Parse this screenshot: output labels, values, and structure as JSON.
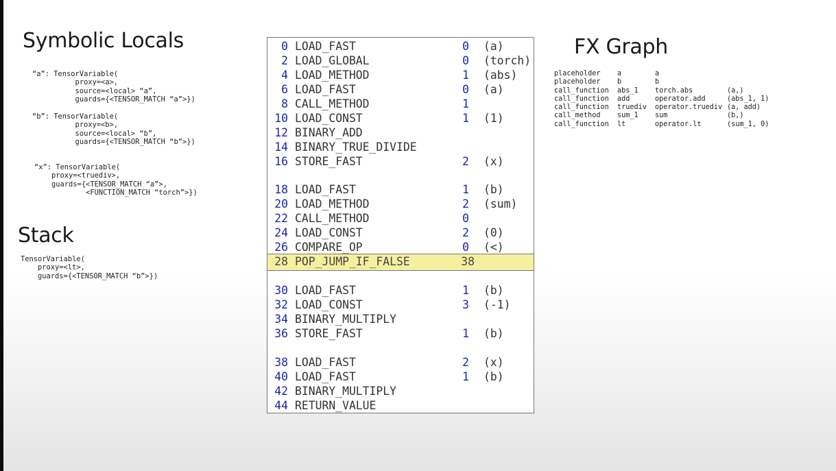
{
  "titles": {
    "symbolic_locals": "Symbolic Locals",
    "stack": "Stack",
    "fx_graph": "FX Graph"
  },
  "symbolic_locals": {
    "a": "“a”: TensorVariable(\n          proxy=<a>,\n          source=<local> “a”,\n          guards={<TENSOR_MATCH “a”>})",
    "b": "“b”: TensorVariable(\n          proxy=<b>,\n          source=<local> “b”,\n          guards={<TENSOR_MATCH “b”>})",
    "x": "“x”: TensorVariable(\n    proxy=<truediv>,\n    guards={<TENSOR_MATCH “a”>,\n            <FUNCTION_MATCH “torch”>})"
  },
  "stack": {
    "entry": "TensorVariable(\n    proxy=<lt>,\n    guards={<TENSOR_MATCH “b”>})"
  },
  "bytecode": [
    {
      "offset": "0",
      "op": "LOAD_FAST",
      "arg": "0",
      "argrepr": "(a)"
    },
    {
      "offset": "2",
      "op": "LOAD_GLOBAL",
      "arg": "0",
      "argrepr": "(torch)"
    },
    {
      "offset": "4",
      "op": "LOAD_METHOD",
      "arg": "1",
      "argrepr": "(abs)"
    },
    {
      "offset": "6",
      "op": "LOAD_FAST",
      "arg": "0",
      "argrepr": "(a)"
    },
    {
      "offset": "8",
      "op": "CALL_METHOD",
      "arg": "1",
      "argrepr": ""
    },
    {
      "offset": "10",
      "op": "LOAD_CONST",
      "arg": "1",
      "argrepr": "(1)"
    },
    {
      "offset": "12",
      "op": "BINARY_ADD",
      "arg": "",
      "argrepr": ""
    },
    {
      "offset": "14",
      "op": "BINARY_TRUE_DIVIDE",
      "arg": "",
      "argrepr": ""
    },
    {
      "offset": "16",
      "op": "STORE_FAST",
      "arg": "2",
      "argrepr": "(x)"
    },
    {
      "offset": "18",
      "op": "LOAD_FAST",
      "arg": "1",
      "argrepr": "(b)"
    },
    {
      "offset": "20",
      "op": "LOAD_METHOD",
      "arg": "2",
      "argrepr": "(sum)"
    },
    {
      "offset": "22",
      "op": "CALL_METHOD",
      "arg": "0",
      "argrepr": ""
    },
    {
      "offset": "24",
      "op": "LOAD_CONST",
      "arg": "2",
      "argrepr": "(0)"
    },
    {
      "offset": "26",
      "op": "COMPARE_OP",
      "arg": "0",
      "argrepr": "(<)"
    },
    {
      "offset": "28",
      "op": "POP_JUMP_IF_FALSE",
      "arg": "38",
      "argrepr": "",
      "highlighted": true
    },
    {
      "offset": "30",
      "op": "LOAD_FAST",
      "arg": "1",
      "argrepr": "(b)"
    },
    {
      "offset": "32",
      "op": "LOAD_CONST",
      "arg": "3",
      "argrepr": "(-1)"
    },
    {
      "offset": "34",
      "op": "BINARY_MULTIPLY",
      "arg": "",
      "argrepr": ""
    },
    {
      "offset": "36",
      "op": "STORE_FAST",
      "arg": "1",
      "argrepr": "(b)"
    },
    {
      "offset": "38",
      "op": "LOAD_FAST",
      "arg": "2",
      "argrepr": "(x)"
    },
    {
      "offset": "40",
      "op": "LOAD_FAST",
      "arg": "1",
      "argrepr": "(b)"
    },
    {
      "offset": "42",
      "op": "BINARY_MULTIPLY",
      "arg": "",
      "argrepr": ""
    },
    {
      "offset": "44",
      "op": "RETURN_VALUE",
      "arg": "",
      "argrepr": ""
    }
  ],
  "fx_graph": [
    [
      "placeholder",
      "a",
      "a",
      ""
    ],
    [
      "placeholder",
      "b",
      "b",
      ""
    ],
    [
      "call_function",
      "abs_1",
      "torch.abs",
      "(a,)"
    ],
    [
      "call_function",
      "add",
      "operator.add",
      "(abs_1, 1)"
    ],
    [
      "call_function",
      "truediv",
      "operator.truediv",
      "(a, add)"
    ],
    [
      "call_method",
      "sum_1",
      "sum",
      "(b,)"
    ],
    [
      "call_function",
      "lt",
      "operator.lt",
      "(sum_1, 0)"
    ]
  ],
  "colors": {
    "offset_blue": "#1a24a8",
    "highlight": "#f5f0a0"
  }
}
